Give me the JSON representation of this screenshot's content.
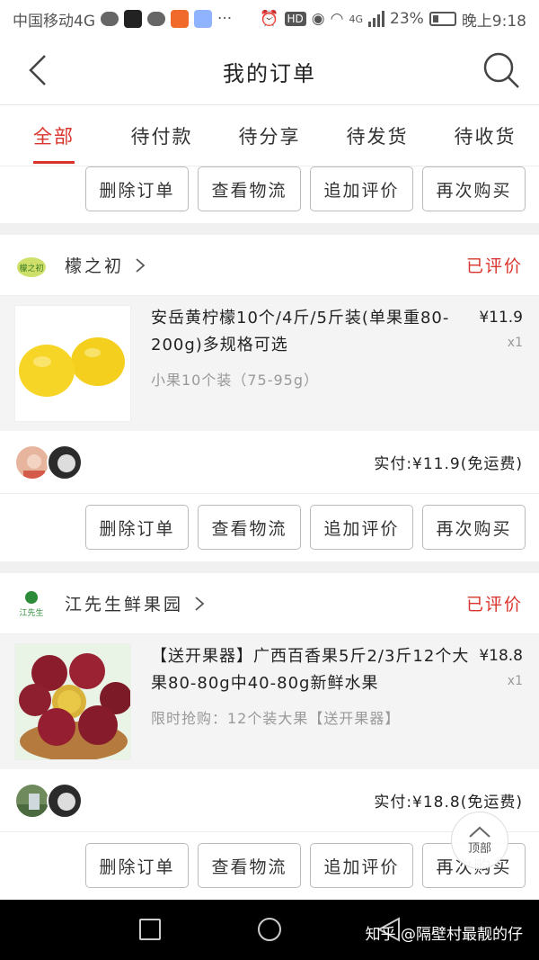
{
  "status_bar": {
    "carrier": "中国移动4G",
    "network": "4G",
    "battery": "23%",
    "time": "晚上9:18"
  },
  "nav": {
    "title": "我的订单"
  },
  "tabs": [
    {
      "label": "全部",
      "active": true
    },
    {
      "label": "待付款"
    },
    {
      "label": "待分享"
    },
    {
      "label": "待发货"
    },
    {
      "label": "待收货"
    }
  ],
  "action_labels": {
    "delete": "删除订单",
    "logistics": "查看物流",
    "review": "追加评价",
    "rebuy": "再次购买"
  },
  "orders": [
    {
      "store": "檬之初",
      "store_logo_text": "檬之初",
      "status": "已评价",
      "product": {
        "title": "安岳黄柠檬10个/4斤/5斤装(单果重80-200g)多规格可选",
        "spec": "小果10个装（75-95g）",
        "price": "¥11.9",
        "qty": "x1"
      },
      "paid_text": "实付:¥11.9(免运费)"
    },
    {
      "store": "江先生鲜果园",
      "store_logo_text": "江先生",
      "status": "已评价",
      "product": {
        "title": "【送开果器】广西百香果5斤2/3斤12个大果80-80g中40-80g新鲜水果",
        "spec": "限时抢购：12个装大果【送开果器】",
        "price": "¥18.8",
        "qty": "x1"
      },
      "paid_text": "实付:¥18.8(免运费)"
    }
  ],
  "top_button": "顶部",
  "watermark": "知乎 @隔壁村最靓的仔",
  "colors": {
    "accent": "#d9342b"
  }
}
